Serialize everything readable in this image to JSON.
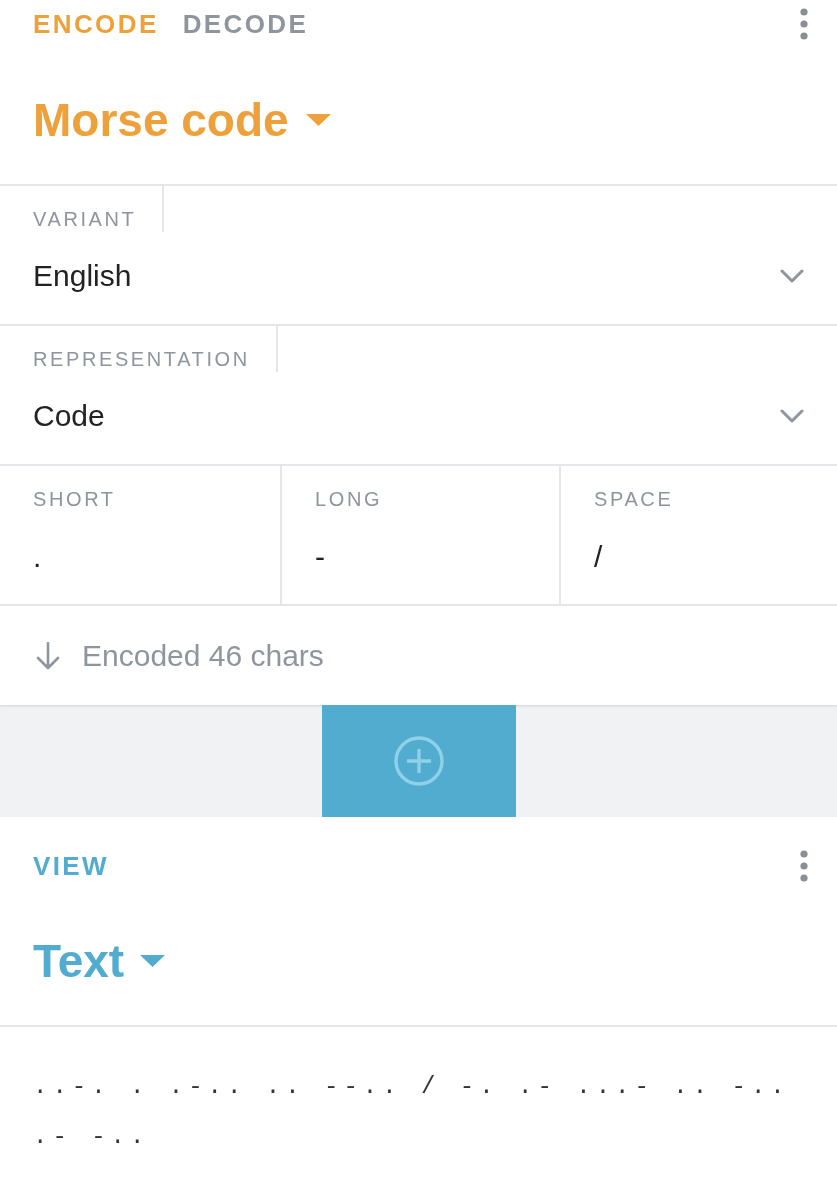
{
  "encoder": {
    "tabs": [
      {
        "label": "ENCODE",
        "selected": true
      },
      {
        "label": "DECODE",
        "selected": false
      }
    ],
    "title": "Morse code",
    "fields": [
      {
        "label": "VARIANT",
        "value": "English"
      },
      {
        "label": "REPRESENTATION",
        "value": "Code"
      }
    ],
    "symbols": [
      {
        "label": "SHORT",
        "value": "."
      },
      {
        "label": "LONG",
        "value": "-"
      },
      {
        "label": "SPACE",
        "value": "/"
      }
    ],
    "status": "Encoded 46 chars"
  },
  "view": {
    "label": "VIEW",
    "title": "Text",
    "output": "..-. . .-.. .. --.. / -. .- ...- .. -.. .- -.."
  }
}
